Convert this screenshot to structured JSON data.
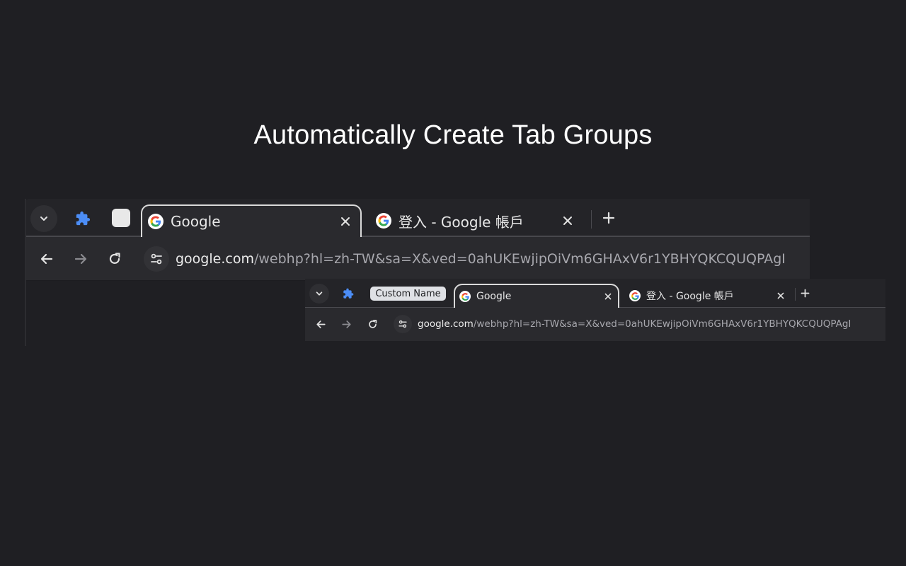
{
  "headline": "Automatically Create Tab Groups",
  "large_browser": {
    "tabs": [
      {
        "title": "Google",
        "favicon": "google-g-icon",
        "active": true
      },
      {
        "title": "登入 - Google 帳戶",
        "favicon": "google-g-icon",
        "active": false
      }
    ],
    "address": {
      "host": "google.com",
      "path": "/webhp?hl=zh-TW&sa=X&ved=0ahUKEwjipOiVm6GHAxV6r1YBHYQKCQUQPAgI"
    }
  },
  "small_browser": {
    "group_name": "Custom Name",
    "tabs": [
      {
        "title": "Google",
        "favicon": "google-g-icon",
        "active": true
      },
      {
        "title": "登入 - Google 帳戶",
        "favicon": "google-g-icon",
        "active": false
      }
    ],
    "address": {
      "host": "google.com",
      "path": "/webhp?hl=zh-TW&sa=X&ved=0ahUKEwjipOiVm6GHAxV6r1YBHYQKCQUQPAgI"
    }
  },
  "colors": {
    "background": "#1f1f23",
    "tab_strip": "#242428",
    "toolbar": "#2a2a2e",
    "extension_icon": "#4c8df6",
    "group_chip": "#dfe1e5"
  }
}
